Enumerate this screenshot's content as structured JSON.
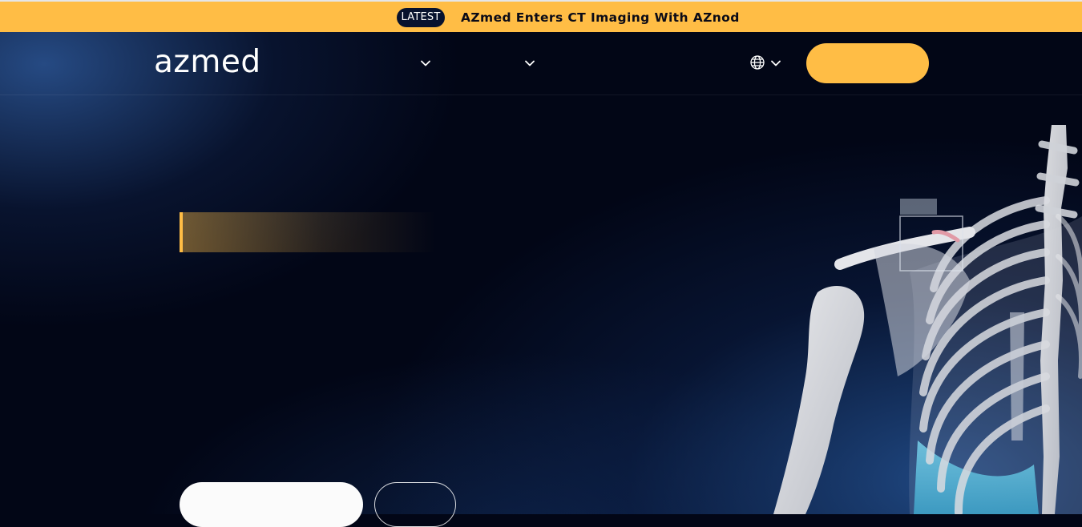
{
  "banner": {
    "badge": "LATEST",
    "headline": "AZmed Enters CT Imaging With AZnod",
    "color": "#ffbd45"
  },
  "header": {
    "logo_text": "azmed",
    "nav_dropdowns": [
      {
        "icon": "chevron-down-icon"
      },
      {
        "icon": "chevron-down-icon"
      }
    ],
    "language_icon": "globe-icon",
    "cta_label": ""
  },
  "hero": {
    "tagline": "",
    "headline": "",
    "primary_button_label": "",
    "secondary_button_label": "",
    "illustration": "skeleton-illustration",
    "accent_color": "#ffbd45"
  }
}
